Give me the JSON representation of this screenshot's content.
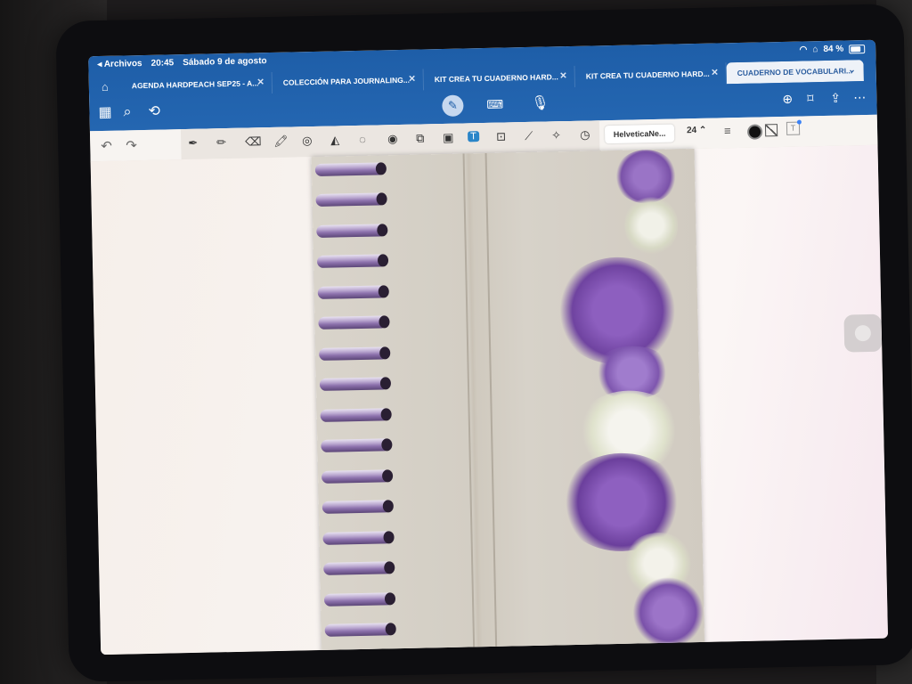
{
  "status": {
    "back_label": "◂ Archivos",
    "time": "20:45",
    "date": "Sábado 9 de agosto",
    "battery": "84 %"
  },
  "tabs": [
    {
      "label": "AGENDA HARDPEACH SEP25 - A..."
    },
    {
      "label": "COLECCIÓN PARA JOURNALING..."
    },
    {
      "label": "KIT CREA TU CUADERNO HARD..."
    },
    {
      "label": "KIT CREA TU CUADERNO HARD..."
    },
    {
      "label": "CUADERNO DE VOCABULARI..."
    }
  ],
  "active_tab_index": 4,
  "toolbar": {
    "font_name": "HelveticaNe...",
    "font_size": "24",
    "size_stepper_glyph": "⌃",
    "text_style_glyph": "T"
  },
  "icons": {
    "home": "house-icon",
    "grid": "grid-icon",
    "search": "search-icon",
    "lasso": "lasso-select-icon",
    "pen": "pen-mode-icon",
    "keyboard": "keyboard-icon",
    "mic": "microphone-icon",
    "new_page": "new-page-icon",
    "bookmark": "bookmark-icon",
    "share": "share-icon",
    "more": "more-icon"
  },
  "colors": {
    "accent_blue": "#1e5ea8",
    "selected_tool": "#2a85c8",
    "ring_purple": "#8d72ad",
    "flower_purple": "#8a5bb8"
  }
}
